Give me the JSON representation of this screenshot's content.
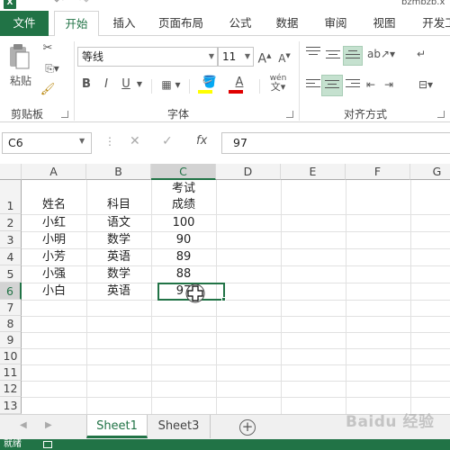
{
  "app": {
    "logo_letter": "X",
    "title": "bzmbzb.x",
    "undo_icon": "undo-icon",
    "redo_icon": "redo-icon"
  },
  "tabs": [
    {
      "label": "文件"
    },
    {
      "label": "开始"
    },
    {
      "label": "插入"
    },
    {
      "label": "页面布局"
    },
    {
      "label": "公式"
    },
    {
      "label": "数据"
    },
    {
      "label": "审阅"
    },
    {
      "label": "视图"
    },
    {
      "label": "开发工"
    }
  ],
  "active_tab": "开始",
  "ribbon": {
    "clipboard": {
      "group_label": "剪贴板",
      "paste_label": "粘贴"
    },
    "font": {
      "group_label": "字体",
      "font_name": "等线",
      "font_size": "11",
      "bold": "B",
      "italic": "I",
      "underline": "U",
      "grow": "A",
      "shrink": "A",
      "phonetic": "wén",
      "fill_color": "#ffff00",
      "font_color": "#e00000"
    },
    "alignment": {
      "group_label": "对齐方式"
    }
  },
  "formula_bar": {
    "name_box": "C6",
    "fx": "fx",
    "value": "97"
  },
  "columns": [
    "A",
    "B",
    "C",
    "D",
    "E",
    "F",
    "G"
  ],
  "selected_column": "C",
  "rows": [
    "1",
    "2",
    "3",
    "4",
    "5",
    "6",
    "7",
    "8",
    "9",
    "10",
    "11",
    "12",
    "13"
  ],
  "selected_row": "6",
  "table": {
    "header": {
      "name": "姓名",
      "subject": "科目",
      "score_line1": "考试",
      "score_line2": "成绩"
    },
    "data": [
      {
        "name": "小红",
        "subject": "语文",
        "score": "100"
      },
      {
        "name": "小明",
        "subject": "数学",
        "score": "90"
      },
      {
        "name": "小芳",
        "subject": "英语",
        "score": "89"
      },
      {
        "name": "小强",
        "subject": "数学",
        "score": "88"
      },
      {
        "name": "小白",
        "subject": "英语",
        "score": "97"
      }
    ]
  },
  "sheets": {
    "tab1": "Sheet1",
    "tab2": "Sheet3",
    "active": "Sheet1"
  },
  "watermark": "Baidu 经验",
  "status": {
    "text": "就绪"
  },
  "colors": {
    "accent": "#217346",
    "selection_highlight": "#c5e1cf"
  }
}
